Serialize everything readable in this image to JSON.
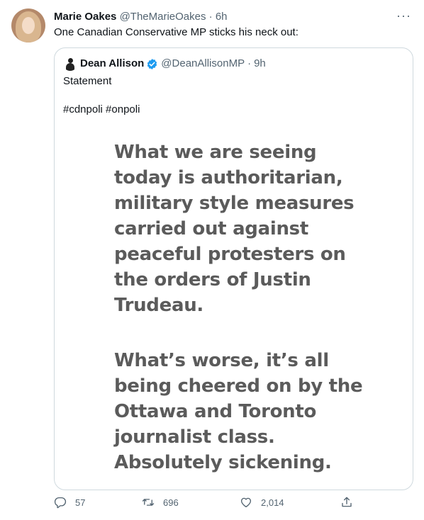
{
  "tweet": {
    "author_name": "Marie Oakes",
    "author_handle": "@TheMarieOakes",
    "dot": "·",
    "time": "6h",
    "more_label": "···",
    "text": "One Canadian Conservative MP sticks his neck out:"
  },
  "quote": {
    "author_name": "Dean Allison",
    "author_handle": "@DeanAllisonMP",
    "dot": "·",
    "time": "9h",
    "text_line1": "Statement",
    "text_line2": "#cdnpoli #onpoli",
    "image_lines_a": [
      "What we are seeing",
      "today is authoritarian,",
      "military style measures",
      "carried out against",
      "peaceful protesters on",
      "the orders of Justin",
      "Trudeau."
    ],
    "image_lines_b": [
      "What’s worse, it’s all",
      "being cheered on by the",
      "Ottawa and Toronto",
      "journalist class.",
      "Absolutely sickening."
    ]
  },
  "actions": {
    "reply_count": "57",
    "retweet_count": "696",
    "like_count": "2,014"
  },
  "icons": {
    "verified_color": "#1d9bf0",
    "reply": "reply-icon",
    "retweet": "retweet-icon",
    "like": "heart-icon",
    "share": "share-icon"
  }
}
